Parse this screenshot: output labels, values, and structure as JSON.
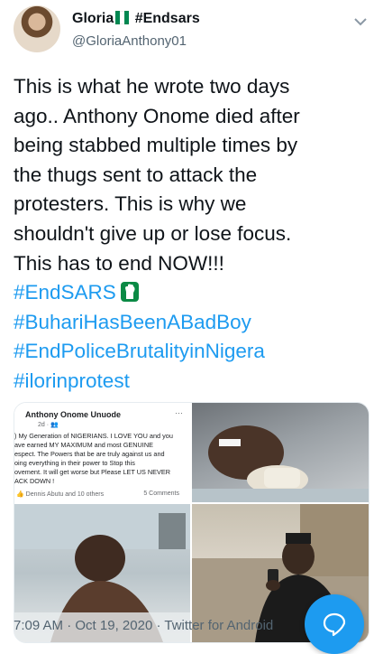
{
  "author": {
    "display_name": "Gloria",
    "display_suffix": "#Endsars",
    "handle": "@GloriaAnthony01",
    "flag_colors": [
      "#008751",
      "#ffffff",
      "#008751"
    ]
  },
  "tweet": {
    "text_lines": [
      "This is what he wrote two days",
      "ago.. Anthony Onome died after",
      "being stabbed multiple times by",
      "the thugs sent to attack the",
      "protesters. This is why we",
      "shouldn't give up or lose focus.",
      "This has to end NOW!!!"
    ],
    "hashtags": [
      "#EndSARS",
      "#BuhariHasBeenABadBoy",
      "#EndPoliceBrutalityinNigera",
      "#ilorinprotest"
    ]
  },
  "media": {
    "fb_post": {
      "name": "Anthony Onome Unuode",
      "meta": "2d · 👥",
      "more": "···",
      "body_lines": [
        ") My Generation of NIGERIANS. I LOVE YOU and you",
        "ave earned MY MAXIMUM and most GENUINE",
        "espect. The Powers that be are truly against us and",
        "oing everything in their power to Stop this",
        "ovement. It will get worse but Please LET US NEVER",
        "ACK DOWN !"
      ],
      "reactions": "Dennis Abutu and 10 others",
      "comments": "5 Comments"
    }
  },
  "footer": {
    "time": "7:09 AM",
    "separator": "·",
    "date": "Oct 19, 2020",
    "source": "Twitter for Android"
  },
  "colors": {
    "link": "#1d9bf0",
    "secondary_text": "#536471",
    "fab": "#1d9bf0"
  },
  "icons": [
    "chevron-down-icon",
    "raised-fist-icon",
    "compose-reply-icon"
  ]
}
